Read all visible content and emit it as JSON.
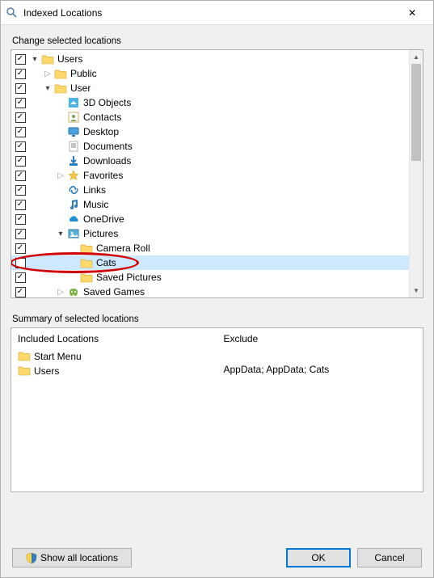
{
  "window": {
    "title": "Indexed Locations",
    "close_glyph": "✕"
  },
  "sections": {
    "change_label": "Change selected locations",
    "summary_label": "Summary of selected locations"
  },
  "tree": {
    "rows": [
      {
        "checked": true,
        "indent": 0,
        "expander": "expanded",
        "icon": "folder",
        "label": "Users"
      },
      {
        "checked": true,
        "indent": 1,
        "expander": "collapsed",
        "icon": "folder",
        "label": "Public"
      },
      {
        "checked": true,
        "indent": 1,
        "expander": "expanded",
        "icon": "folder",
        "label": "User"
      },
      {
        "checked": true,
        "indent": 2,
        "expander": "none",
        "icon": "3dobjects",
        "label": "3D Objects"
      },
      {
        "checked": true,
        "indent": 2,
        "expander": "none",
        "icon": "contacts",
        "label": "Contacts"
      },
      {
        "checked": true,
        "indent": 2,
        "expander": "none",
        "icon": "desktop",
        "label": "Desktop"
      },
      {
        "checked": true,
        "indent": 2,
        "expander": "none",
        "icon": "documents",
        "label": "Documents"
      },
      {
        "checked": true,
        "indent": 2,
        "expander": "none",
        "icon": "downloads",
        "label": "Downloads"
      },
      {
        "checked": true,
        "indent": 2,
        "expander": "collapsed",
        "icon": "favorites",
        "label": "Favorites"
      },
      {
        "checked": true,
        "indent": 2,
        "expander": "none",
        "icon": "links",
        "label": "Links"
      },
      {
        "checked": true,
        "indent": 2,
        "expander": "none",
        "icon": "music",
        "label": "Music"
      },
      {
        "checked": true,
        "indent": 2,
        "expander": "none",
        "icon": "onedrive",
        "label": "OneDrive"
      },
      {
        "checked": true,
        "indent": 2,
        "expander": "expanded",
        "icon": "pictures",
        "label": "Pictures"
      },
      {
        "checked": true,
        "indent": 3,
        "expander": "none",
        "icon": "folder",
        "label": "Camera Roll"
      },
      {
        "checked": false,
        "indent": 3,
        "expander": "none",
        "icon": "folder",
        "label": "Cats",
        "selected": true
      },
      {
        "checked": true,
        "indent": 3,
        "expander": "none",
        "icon": "folder",
        "label": "Saved Pictures"
      },
      {
        "checked": true,
        "indent": 2,
        "expander": "collapsed",
        "icon": "savedgames",
        "label": "Saved Games"
      }
    ]
  },
  "summary": {
    "included_header": "Included Locations",
    "exclude_header": "Exclude",
    "included_items": [
      "Start Menu",
      "Users"
    ],
    "exclude_text": "AppData; AppData; Cats"
  },
  "buttons": {
    "show_all": "Show all locations",
    "ok": "OK",
    "cancel": "Cancel"
  }
}
